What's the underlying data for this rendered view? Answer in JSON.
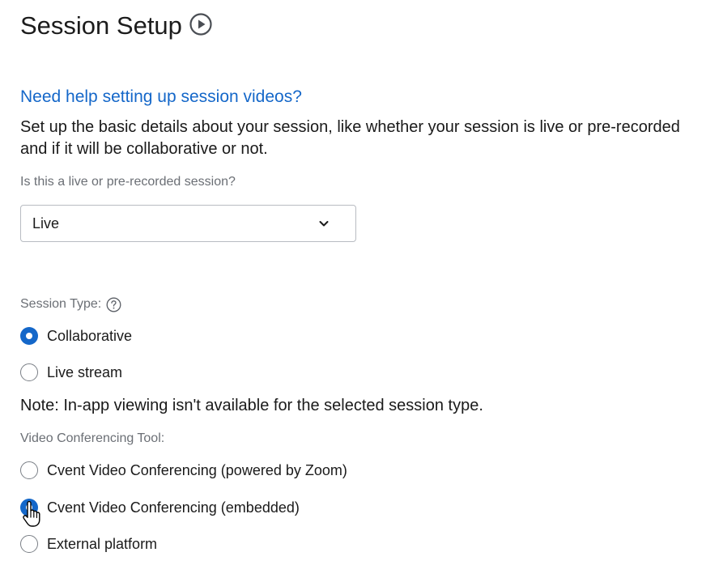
{
  "header": {
    "title": "Session Setup",
    "play_icon": "play-circle-icon"
  },
  "help_link": "Need help setting up session videos?",
  "intro": "Set up the basic details about your session, like whether your session is live or pre-recorded and if it will be collaborative or not.",
  "session_mode": {
    "label": "Is this a live or pre-recorded session?",
    "selected": "Live",
    "chevron_icon": "chevron-down-icon"
  },
  "session_type": {
    "label": "Session Type:",
    "help_icon": "question-circle-icon",
    "options": [
      {
        "label": "Collaborative",
        "checked": true
      },
      {
        "label": "Live stream",
        "checked": false
      }
    ]
  },
  "note": "Note: In-app viewing isn't available for the selected session type.",
  "video_tool": {
    "label": "Video Conferencing Tool:",
    "options": [
      {
        "label": "Cvent Video Conferencing (powered by Zoom)",
        "checked": false
      },
      {
        "label": "Cvent Video Conferencing (embedded)",
        "checked": true
      },
      {
        "label": "External platform",
        "checked": false
      }
    ]
  },
  "colors": {
    "accent": "#1467c9",
    "text": "#1a1a1a",
    "muted_label": "#6b6f75",
    "border": "#b8bcc2"
  }
}
